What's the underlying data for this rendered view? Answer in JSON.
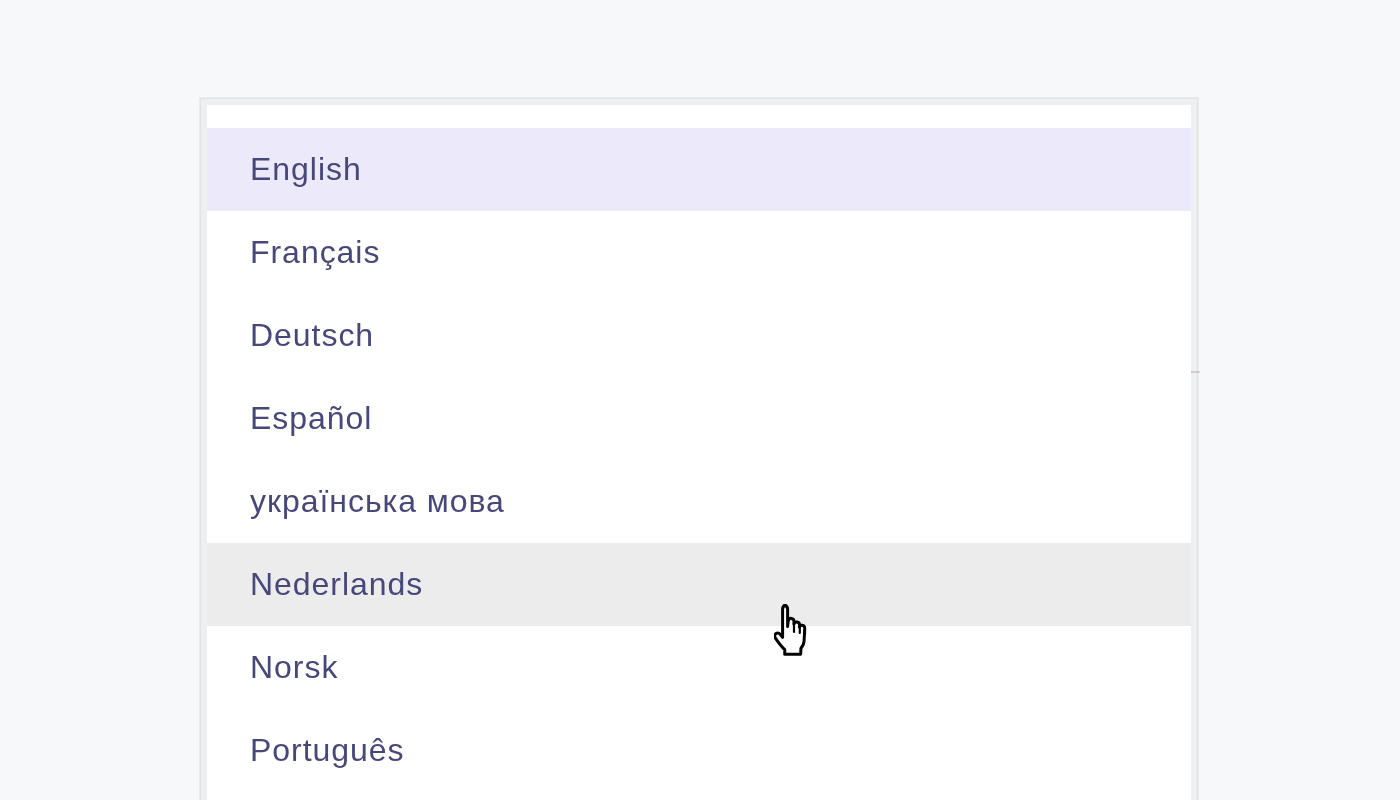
{
  "language_menu": {
    "options": [
      {
        "label": "English",
        "selected": true,
        "hovered": false
      },
      {
        "label": "Français",
        "selected": false,
        "hovered": false
      },
      {
        "label": "Deutsch",
        "selected": false,
        "hovered": false
      },
      {
        "label": "Español",
        "selected": false,
        "hovered": false
      },
      {
        "label": "українська мова",
        "selected": false,
        "hovered": false
      },
      {
        "label": "Nederlands",
        "selected": false,
        "hovered": true
      },
      {
        "label": "Norsk",
        "selected": false,
        "hovered": false
      },
      {
        "label": "Português",
        "selected": false,
        "hovered": false
      }
    ]
  }
}
